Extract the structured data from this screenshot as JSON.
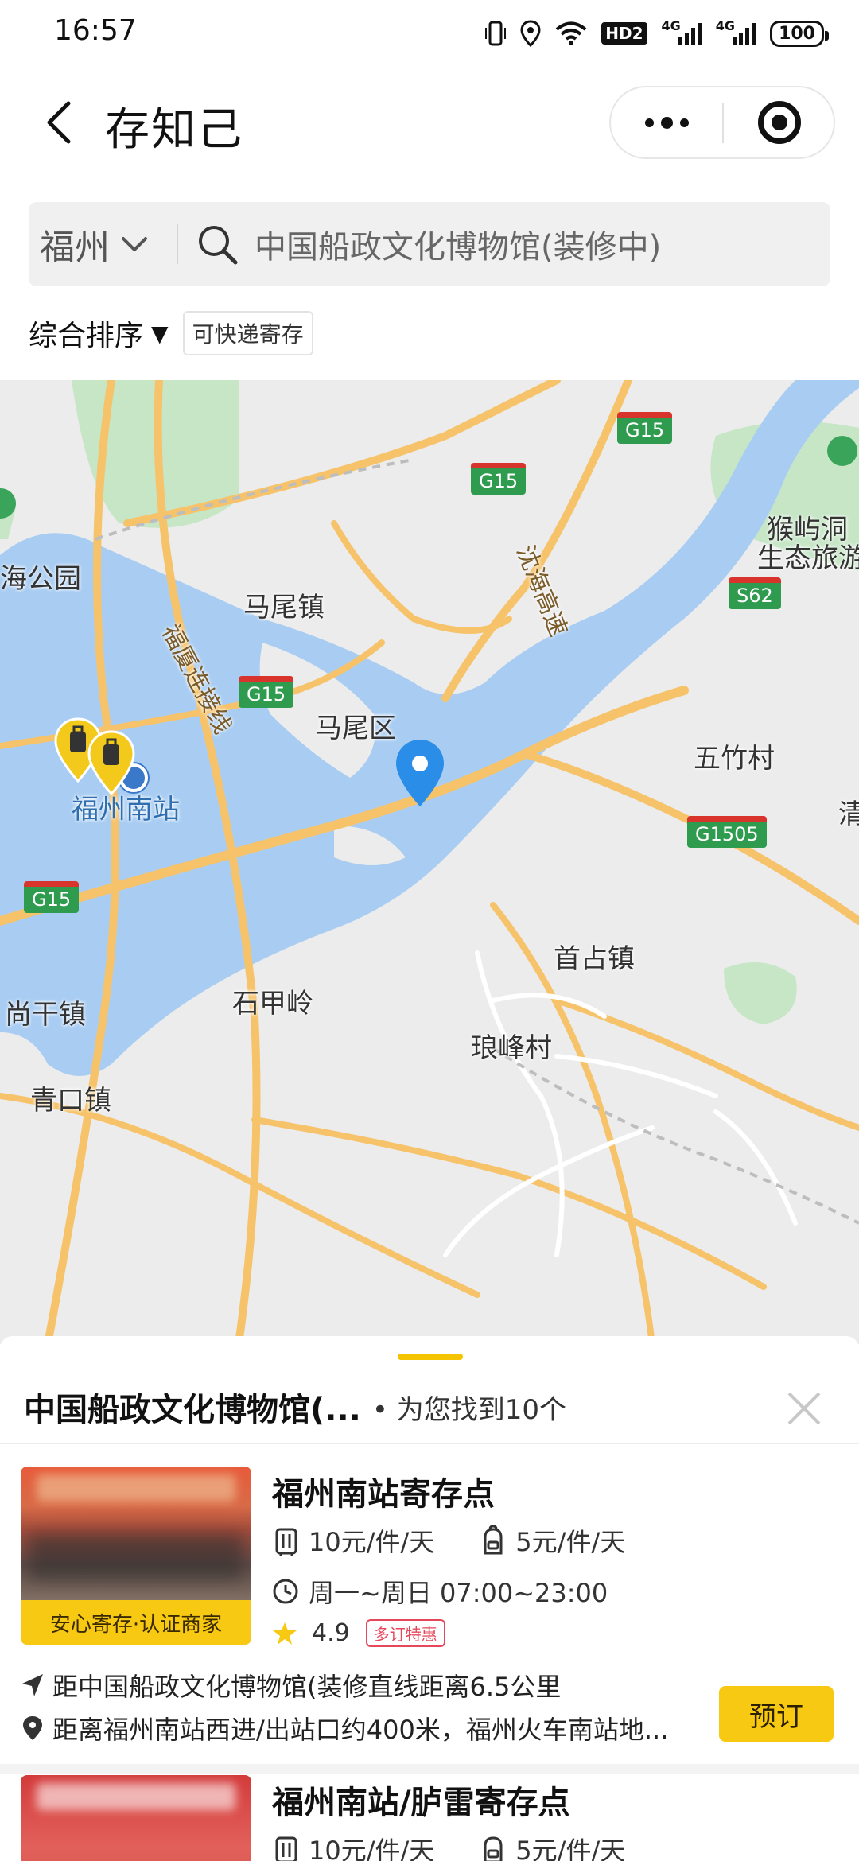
{
  "status_bar": {
    "time": "16:57",
    "hd": "HD2",
    "net1": "4G",
    "net2": "4G",
    "battery": "100"
  },
  "nav": {
    "title": "存知己"
  },
  "search": {
    "city": "福州",
    "query": "中国船政文化博物馆(装修中)"
  },
  "filters": {
    "sort": "综合排序",
    "sort_arrow": "▼",
    "chip": "可快递寄存"
  },
  "map": {
    "labels": {
      "mawei_town": "马尾镇",
      "mawei_district": "马尾区",
      "wuzhu": "五竹村",
      "houyu": "猴屿洞",
      "eco": "生态旅游",
      "hai_park": "海公园",
      "fuzhou_south": "福州南站",
      "shouzhan": "首占镇",
      "shijialing": "石甲岭",
      "shanggan": "尚干镇",
      "langfeng": "琅峰村",
      "qingkou": "青口镇",
      "qing": "清",
      "shenhai": "沈海高速",
      "fuxia": "福厦连接线"
    },
    "shields": {
      "g15_a": "G15",
      "g15_b": "G15",
      "g15_c": "G15",
      "g15_d": "G15",
      "s62": "S62",
      "g1505": "G1505"
    }
  },
  "sheet": {
    "title": "中国船政文化博物馆(...",
    "count_text": "• 为您找到10个",
    "items": [
      {
        "name": "福州南站寄存点",
        "badge": "安心寄存·认证商家",
        "price_large": "10元/件/天",
        "price_small": "5元/件/天",
        "hours": "周一~周日 07:00~23:00",
        "rating": "4.9",
        "promo": "多订特惠",
        "distance": "距中国船政文化博物馆(装修直线距离6.5公里",
        "address": "距离福州南站西进/出站口约400米，福州火车南站地...",
        "book": "预订"
      },
      {
        "name": "福州南站/胪雷寄存点",
        "price_large": "10元/件/天",
        "price_small": "5元/件/天"
      }
    ]
  },
  "colors": {
    "accent": "#f8c913",
    "map_water": "#a9cdf2",
    "map_green": "#c6e6c6",
    "road": "#f6c36a",
    "pin_blue": "#2a8ee8"
  }
}
